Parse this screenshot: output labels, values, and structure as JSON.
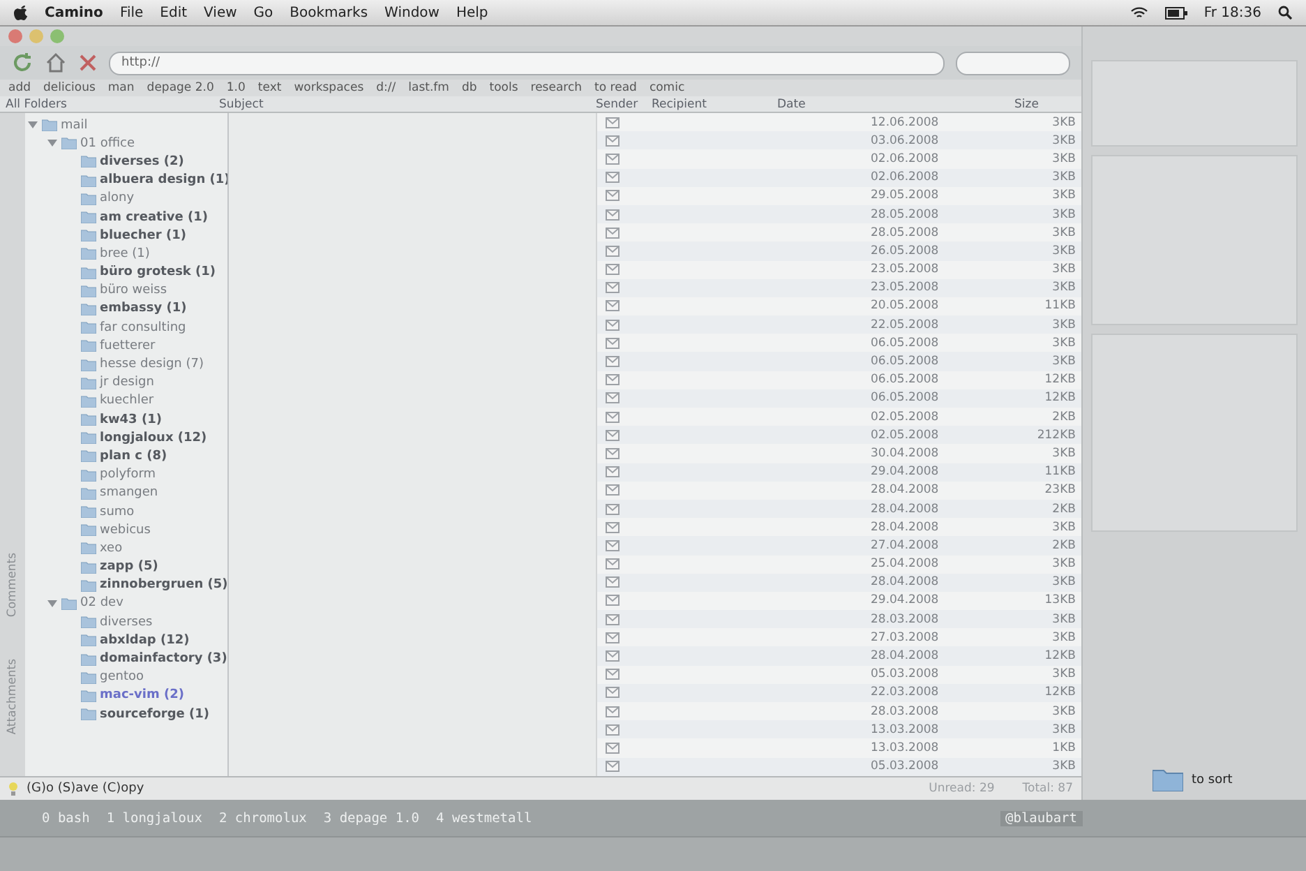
{
  "menu_bar": {
    "app": "Camino",
    "items": [
      "File",
      "Edit",
      "View",
      "Go",
      "Bookmarks",
      "Window",
      "Help"
    ],
    "clock": "Fr 18:36"
  },
  "toolbar": {
    "url": "http://"
  },
  "bookmarks": [
    "add",
    "delicious",
    "man",
    "depage 2.0",
    "1.0",
    "text",
    "workspaces",
    "d://",
    "last.fm",
    "db",
    "tools",
    "research",
    "to read",
    "comic"
  ],
  "columns": {
    "folders": "All Folders",
    "subject": "Subject",
    "sender": "Sender",
    "recipient": "Recipient",
    "date": "Date",
    "size": "Size"
  },
  "folders": [
    {
      "name": "mail",
      "expanded": true,
      "children": [
        {
          "name": "01 office",
          "expanded": true,
          "children": [
            {
              "name": "diverses (2)",
              "unread": true,
              "new": false
            },
            {
              "name": "albuera design (1)",
              "unread": true,
              "new": false
            },
            {
              "name": "alony",
              "unread": false,
              "new": false
            },
            {
              "name": "am creative (1)",
              "unread": true,
              "new": false
            },
            {
              "name": "bluecher (1)",
              "unread": true,
              "new": false
            },
            {
              "name": "bree (1)",
              "unread": false,
              "new": false
            },
            {
              "name": "büro grotesk (1)",
              "unread": true,
              "new": false
            },
            {
              "name": "büro weiss",
              "unread": false,
              "new": false
            },
            {
              "name": "embassy (1)",
              "unread": true,
              "new": false
            },
            {
              "name": "far consulting",
              "unread": false,
              "new": false
            },
            {
              "name": "fuetterer",
              "unread": false,
              "new": false
            },
            {
              "name": "hesse design (7)",
              "unread": false,
              "new": false
            },
            {
              "name": "jr design",
              "unread": false,
              "new": false
            },
            {
              "name": "kuechler",
              "unread": false,
              "new": false
            },
            {
              "name": "kw43 (1)",
              "unread": true,
              "new": false
            },
            {
              "name": "longjaloux (12)",
              "unread": true,
              "new": false
            },
            {
              "name": "plan c (8)",
              "unread": true,
              "new": false
            },
            {
              "name": "polyform",
              "unread": false,
              "new": false
            },
            {
              "name": "smangen",
              "unread": false,
              "new": false
            },
            {
              "name": "sumo",
              "unread": false,
              "new": false
            },
            {
              "name": "webicus",
              "unread": false,
              "new": false
            },
            {
              "name": "xeo",
              "unread": false,
              "new": false
            },
            {
              "name": "zapp (5)",
              "unread": true,
              "new": false
            },
            {
              "name": "zinnobergruen (5)",
              "unread": true,
              "new": false
            }
          ]
        },
        {
          "name": "02 dev",
          "expanded": true,
          "children": [
            {
              "name": "diverses",
              "unread": false,
              "new": false
            },
            {
              "name": "abxldap (12)",
              "unread": true,
              "new": false
            },
            {
              "name": "domainfactory (3)",
              "unread": true,
              "new": false
            },
            {
              "name": "gentoo",
              "unread": false,
              "new": false
            },
            {
              "name": "mac-vim (2)",
              "unread": true,
              "new": true
            },
            {
              "name": "sourceforge (1)",
              "unread": true,
              "new": false
            }
          ]
        }
      ]
    }
  ],
  "messages": [
    {
      "date": "12.06.2008",
      "size": "3KB"
    },
    {
      "date": "03.06.2008",
      "size": "3KB"
    },
    {
      "date": "02.06.2008",
      "size": "3KB"
    },
    {
      "date": "02.06.2008",
      "size": "3KB"
    },
    {
      "date": "29.05.2008",
      "size": "3KB"
    },
    {
      "date": "28.05.2008",
      "size": "3KB"
    },
    {
      "date": "28.05.2008",
      "size": "3KB"
    },
    {
      "date": "26.05.2008",
      "size": "3KB"
    },
    {
      "date": "23.05.2008",
      "size": "3KB"
    },
    {
      "date": "23.05.2008",
      "size": "3KB"
    },
    {
      "date": "20.05.2008",
      "size": "11KB"
    },
    {
      "date": "22.05.2008",
      "size": "3KB"
    },
    {
      "date": "06.05.2008",
      "size": "3KB"
    },
    {
      "date": "06.05.2008",
      "size": "3KB"
    },
    {
      "date": "06.05.2008",
      "size": "12KB"
    },
    {
      "date": "06.05.2008",
      "size": "12KB"
    },
    {
      "date": "02.05.2008",
      "size": "2KB"
    },
    {
      "date": "02.05.2008",
      "size": "212KB"
    },
    {
      "date": "30.04.2008",
      "size": "3KB"
    },
    {
      "date": "29.04.2008",
      "size": "11KB"
    },
    {
      "date": "28.04.2008",
      "size": "23KB"
    },
    {
      "date": "28.04.2008",
      "size": "2KB"
    },
    {
      "date": "28.04.2008",
      "size": "3KB"
    },
    {
      "date": "27.04.2008",
      "size": "2KB"
    },
    {
      "date": "25.04.2008",
      "size": "3KB"
    },
    {
      "date": "28.04.2008",
      "size": "3KB"
    },
    {
      "date": "29.04.2008",
      "size": "13KB"
    },
    {
      "date": "28.03.2008",
      "size": "3KB"
    },
    {
      "date": "27.03.2008",
      "size": "3KB"
    },
    {
      "date": "28.04.2008",
      "size": "12KB"
    },
    {
      "date": "05.03.2008",
      "size": "3KB"
    },
    {
      "date": "22.03.2008",
      "size": "12KB"
    },
    {
      "date": "28.03.2008",
      "size": "3KB"
    },
    {
      "date": "13.03.2008",
      "size": "3KB"
    },
    {
      "date": "13.03.2008",
      "size": "1KB"
    },
    {
      "date": "05.03.2008",
      "size": "3KB"
    }
  ],
  "side_tabs": [
    "Attachments",
    "Comments"
  ],
  "status_bar": {
    "keys": "(G)o (S)ave (C)opy",
    "unread": "Unread: 29",
    "total": "Total: 87"
  },
  "terminal": {
    "windows": [
      "0 bash",
      "1 longjaloux",
      "2 chromolux",
      "3 depage 1.0",
      "4 westmetall"
    ],
    "host": "@blaubart"
  },
  "desktop": {
    "folder": "to sort"
  }
}
